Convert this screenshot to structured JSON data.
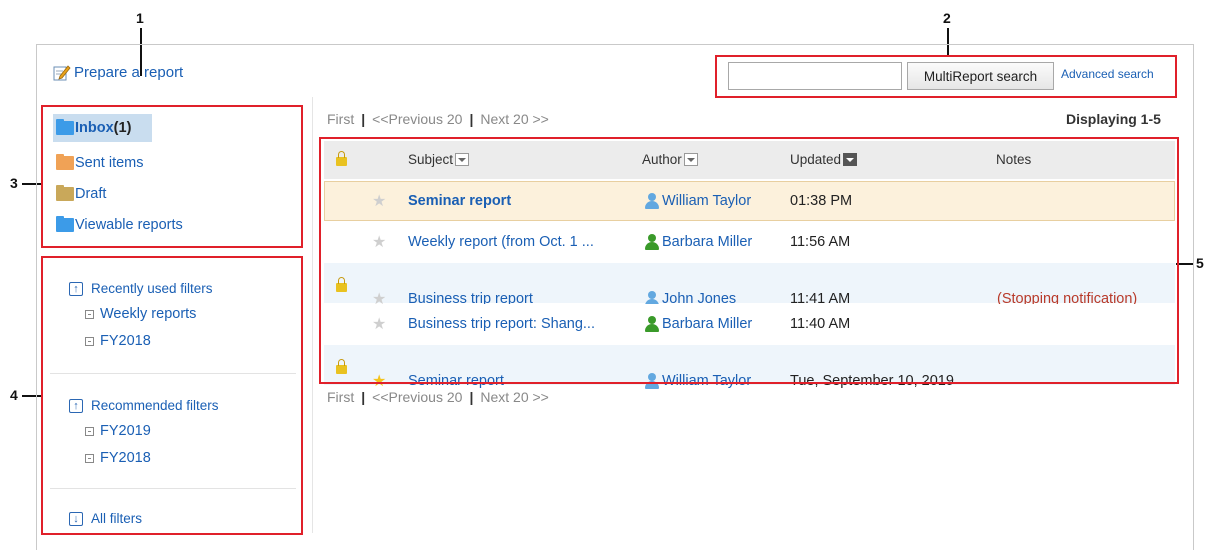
{
  "callouts": [
    "1",
    "2",
    "3",
    "4",
    "5"
  ],
  "toolbar": {
    "prepare_label": "Prepare a report"
  },
  "search": {
    "placeholder": "",
    "button_label": "MultiReport search",
    "advanced_label": "Advanced search"
  },
  "folders": [
    {
      "label": "Inbox",
      "count": "(1)",
      "color": "#3c9be8",
      "icon": "folder-blue-icon"
    },
    {
      "label": "Sent items",
      "color": "#f0a256",
      "icon": "folder-orange-icon"
    },
    {
      "label": "Draft",
      "color": "#c9a85a",
      "icon": "folder-tan-icon"
    },
    {
      "label": "Viewable reports",
      "color": "#3c9be8",
      "icon": "folder-blue-icon"
    }
  ],
  "filters": {
    "recent": {
      "heading": "Recently used filters",
      "items": [
        "Weekly reports",
        "FY2018"
      ]
    },
    "recommended": {
      "heading": "Recommended filters",
      "items": [
        "FY2019",
        "FY2018"
      ]
    },
    "all_label": "All filters"
  },
  "pager": {
    "first": "First",
    "sep": "|",
    "prev": "<<Previous 20",
    "next": "Next 20 >>",
    "displaying": "Displaying 1-5"
  },
  "table": {
    "headers": {
      "subject": "Subject",
      "author": "Author",
      "updated": "Updated",
      "notes": "Notes"
    },
    "rows": [
      {
        "lock": false,
        "starred": false,
        "unread": true,
        "subject": "Seminar report",
        "author": "William Taylor",
        "author_color": "blue",
        "updated": "01:38 PM",
        "notes": "",
        "bg": "#fcf1dc"
      },
      {
        "lock": false,
        "starred": false,
        "unread": false,
        "subject": "Weekly report (from Oct. 1 ...",
        "author": "Barbara Miller",
        "author_color": "green",
        "updated": "11:56 AM",
        "notes": "",
        "bg": "#ffffff"
      },
      {
        "lock": true,
        "starred": false,
        "unread": false,
        "subject": "Business trip report",
        "author": "John Jones",
        "author_color": "blue",
        "updated": "11:41 AM",
        "notes": "(Stopping notification)",
        "bg": "#eef5fb"
      },
      {
        "lock": false,
        "starred": false,
        "unread": false,
        "subject": "Business trip report: Shang...",
        "author": "Barbara Miller",
        "author_color": "green",
        "updated": "11:40 AM",
        "notes": "",
        "bg": "#ffffff"
      },
      {
        "lock": true,
        "starred": true,
        "unread": false,
        "subject": "Seminar report",
        "author": "William Taylor",
        "author_color": "blue",
        "updated": "Tue, September 10, 2019",
        "notes": "",
        "bg": "#eef5fb"
      }
    ]
  },
  "colors": {
    "callout_border": "#e0202a",
    "link": "#1a5fb4",
    "note": "#b83a2a",
    "selected_row_border": "#e8cfa0"
  }
}
